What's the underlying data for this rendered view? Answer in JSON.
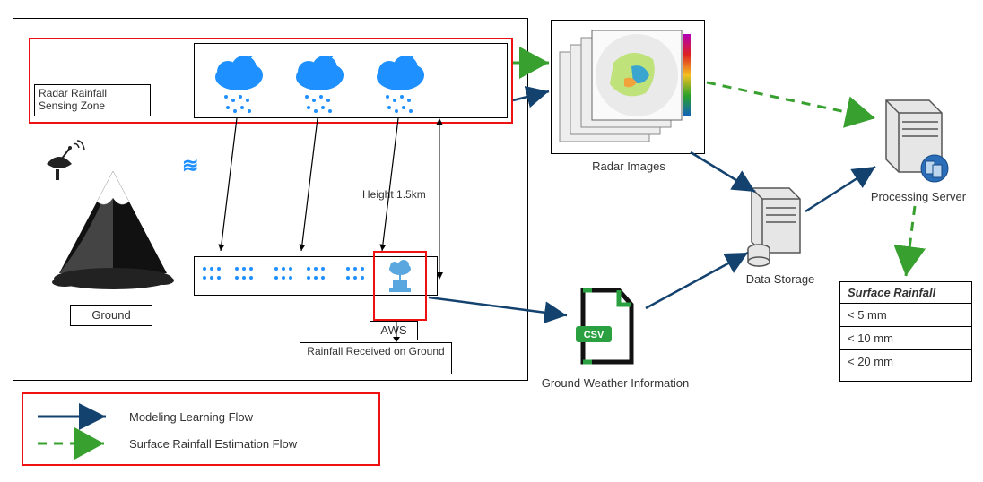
{
  "main": {
    "sensing_zone": "Radar Rainfall Sensing Zone",
    "height_label": "Height 1.5km",
    "ground": "Ground",
    "aws": "AWS",
    "rainfall_received": "Rainfall Received on Ground",
    "wind_glyph": "≋"
  },
  "right": {
    "radar_images": "Radar Images",
    "ground_weather": "Ground Weather Information",
    "data_storage": "Data Storage",
    "processing_server": "Processing Server",
    "csv_badge": "CSV"
  },
  "surface_rainfall": {
    "title": "Surface Rainfall",
    "rows": [
      "< 5 mm",
      "< 10 mm",
      "< 20 mm"
    ]
  },
  "legend": {
    "learning": "Modeling Learning Flow",
    "estimation": "Surface Rainfall Estimation Flow"
  },
  "colors": {
    "blue": "#14426f",
    "green": "#37a02e",
    "cloud": "#1e90ff",
    "red": "#e11"
  }
}
